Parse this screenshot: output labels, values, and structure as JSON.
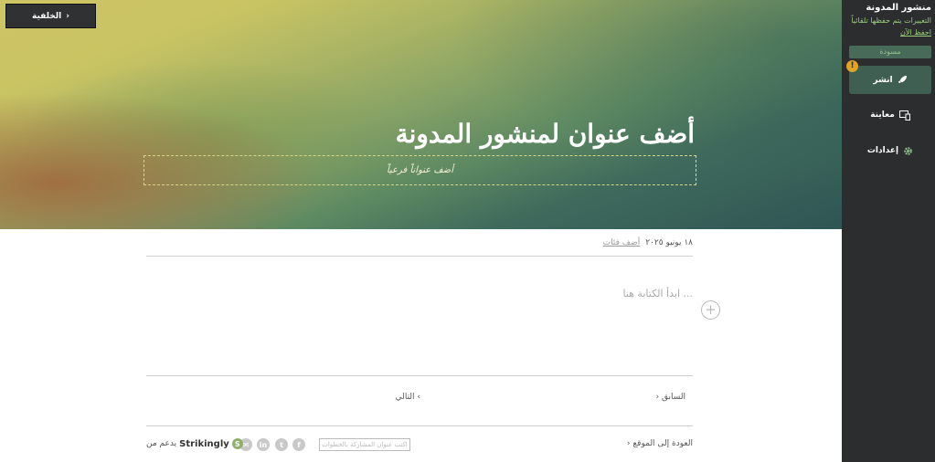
{
  "header": {
    "back_label": "الخلفية"
  },
  "hero": {
    "title": "أضف عنوان لمنشور المدونة",
    "subtitle_placeholder": "أضف عنواناً فرعياً"
  },
  "sidebar": {
    "title": "منشور المدونة",
    "status": "التغييرات يتم حفظها تلقائياً",
    "save_now": "احفظ الآن",
    "draft_badge": "مسودة",
    "warning_mark": "!",
    "publish_label": "انشر",
    "preview_label": "معاينة",
    "settings_label": "إعدادات"
  },
  "post": {
    "date": "١٨ يونيو ٢٠٢٥",
    "add_category": "أضف فئات",
    "body_placeholder": "ابدأ الكتابة هنا ...",
    "add_block_symbol": "+"
  },
  "pagination": {
    "prev_label": "السابق",
    "next_label": "التالي"
  },
  "footer": {
    "back_to_site": "العودة إلى الموقع",
    "share_label": "اكتب عنوان المشاركة بالخطوات",
    "powered_prefix": "يدعم من",
    "brand": "Strikingly",
    "brand_icon_letter": "S",
    "social_icons": [
      "facebook-icon",
      "twitter-icon",
      "linkedin-icon",
      "email-icon"
    ]
  },
  "colors": {
    "sidebar_bg": "#2b2d2f",
    "accent_green": "#9bcf7a",
    "publish_bg": "#3f5f52",
    "warning": "#e0a326"
  }
}
